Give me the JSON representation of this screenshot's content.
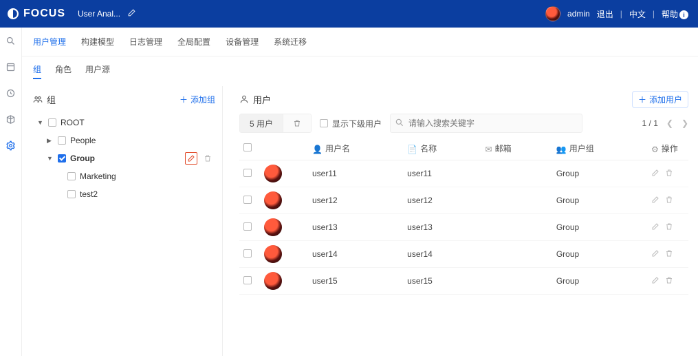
{
  "brand": "FOCUS",
  "tab_label": "User Anal...",
  "top": {
    "admin": "admin",
    "logout": "退出",
    "lang": "中文",
    "help": "帮助"
  },
  "rail": [
    "search",
    "book",
    "clock",
    "cube",
    "gear"
  ],
  "rail_active": 4,
  "nav1": {
    "items": [
      "用户管理",
      "构建模型",
      "日志管理",
      "全局配置",
      "设备管理",
      "系统迁移"
    ],
    "active": 0
  },
  "nav2": {
    "items": [
      "组",
      "角色",
      "用户源"
    ],
    "active": 0
  },
  "group_panel": {
    "title": "组",
    "add_label": "添加组",
    "tree": [
      {
        "depth": 0,
        "caret": "down",
        "checked": false,
        "label": "ROOT",
        "selected": false,
        "actions": false
      },
      {
        "depth": 1,
        "caret": "right",
        "checked": false,
        "label": "People",
        "selected": false,
        "actions": false
      },
      {
        "depth": 1,
        "caret": "down",
        "checked": true,
        "label": "Group",
        "selected": true,
        "actions": true
      },
      {
        "depth": 2,
        "caret": "",
        "checked": false,
        "label": "Marketing",
        "selected": false,
        "actions": false
      },
      {
        "depth": 2,
        "caret": "",
        "checked": false,
        "label": "test2",
        "selected": false,
        "actions": false
      }
    ]
  },
  "user_panel": {
    "title": "用户",
    "add_label": "添加用户",
    "count_label": "5 用户",
    "show_sub_label": "显示下级用户",
    "search_placeholder": "请输入搜索关键字",
    "page_label": "1 / 1",
    "columns": {
      "username": "用户名",
      "name": "名称",
      "email": "邮箱",
      "group": "用户组",
      "action": "操作"
    },
    "rows": [
      {
        "username": "user11",
        "name": "user11",
        "email": "",
        "group": "Group"
      },
      {
        "username": "user12",
        "name": "user12",
        "email": "",
        "group": "Group"
      },
      {
        "username": "user13",
        "name": "user13",
        "email": "",
        "group": "Group"
      },
      {
        "username": "user14",
        "name": "user14",
        "email": "",
        "group": "Group"
      },
      {
        "username": "user15",
        "name": "user15",
        "email": "",
        "group": "Group"
      }
    ]
  }
}
